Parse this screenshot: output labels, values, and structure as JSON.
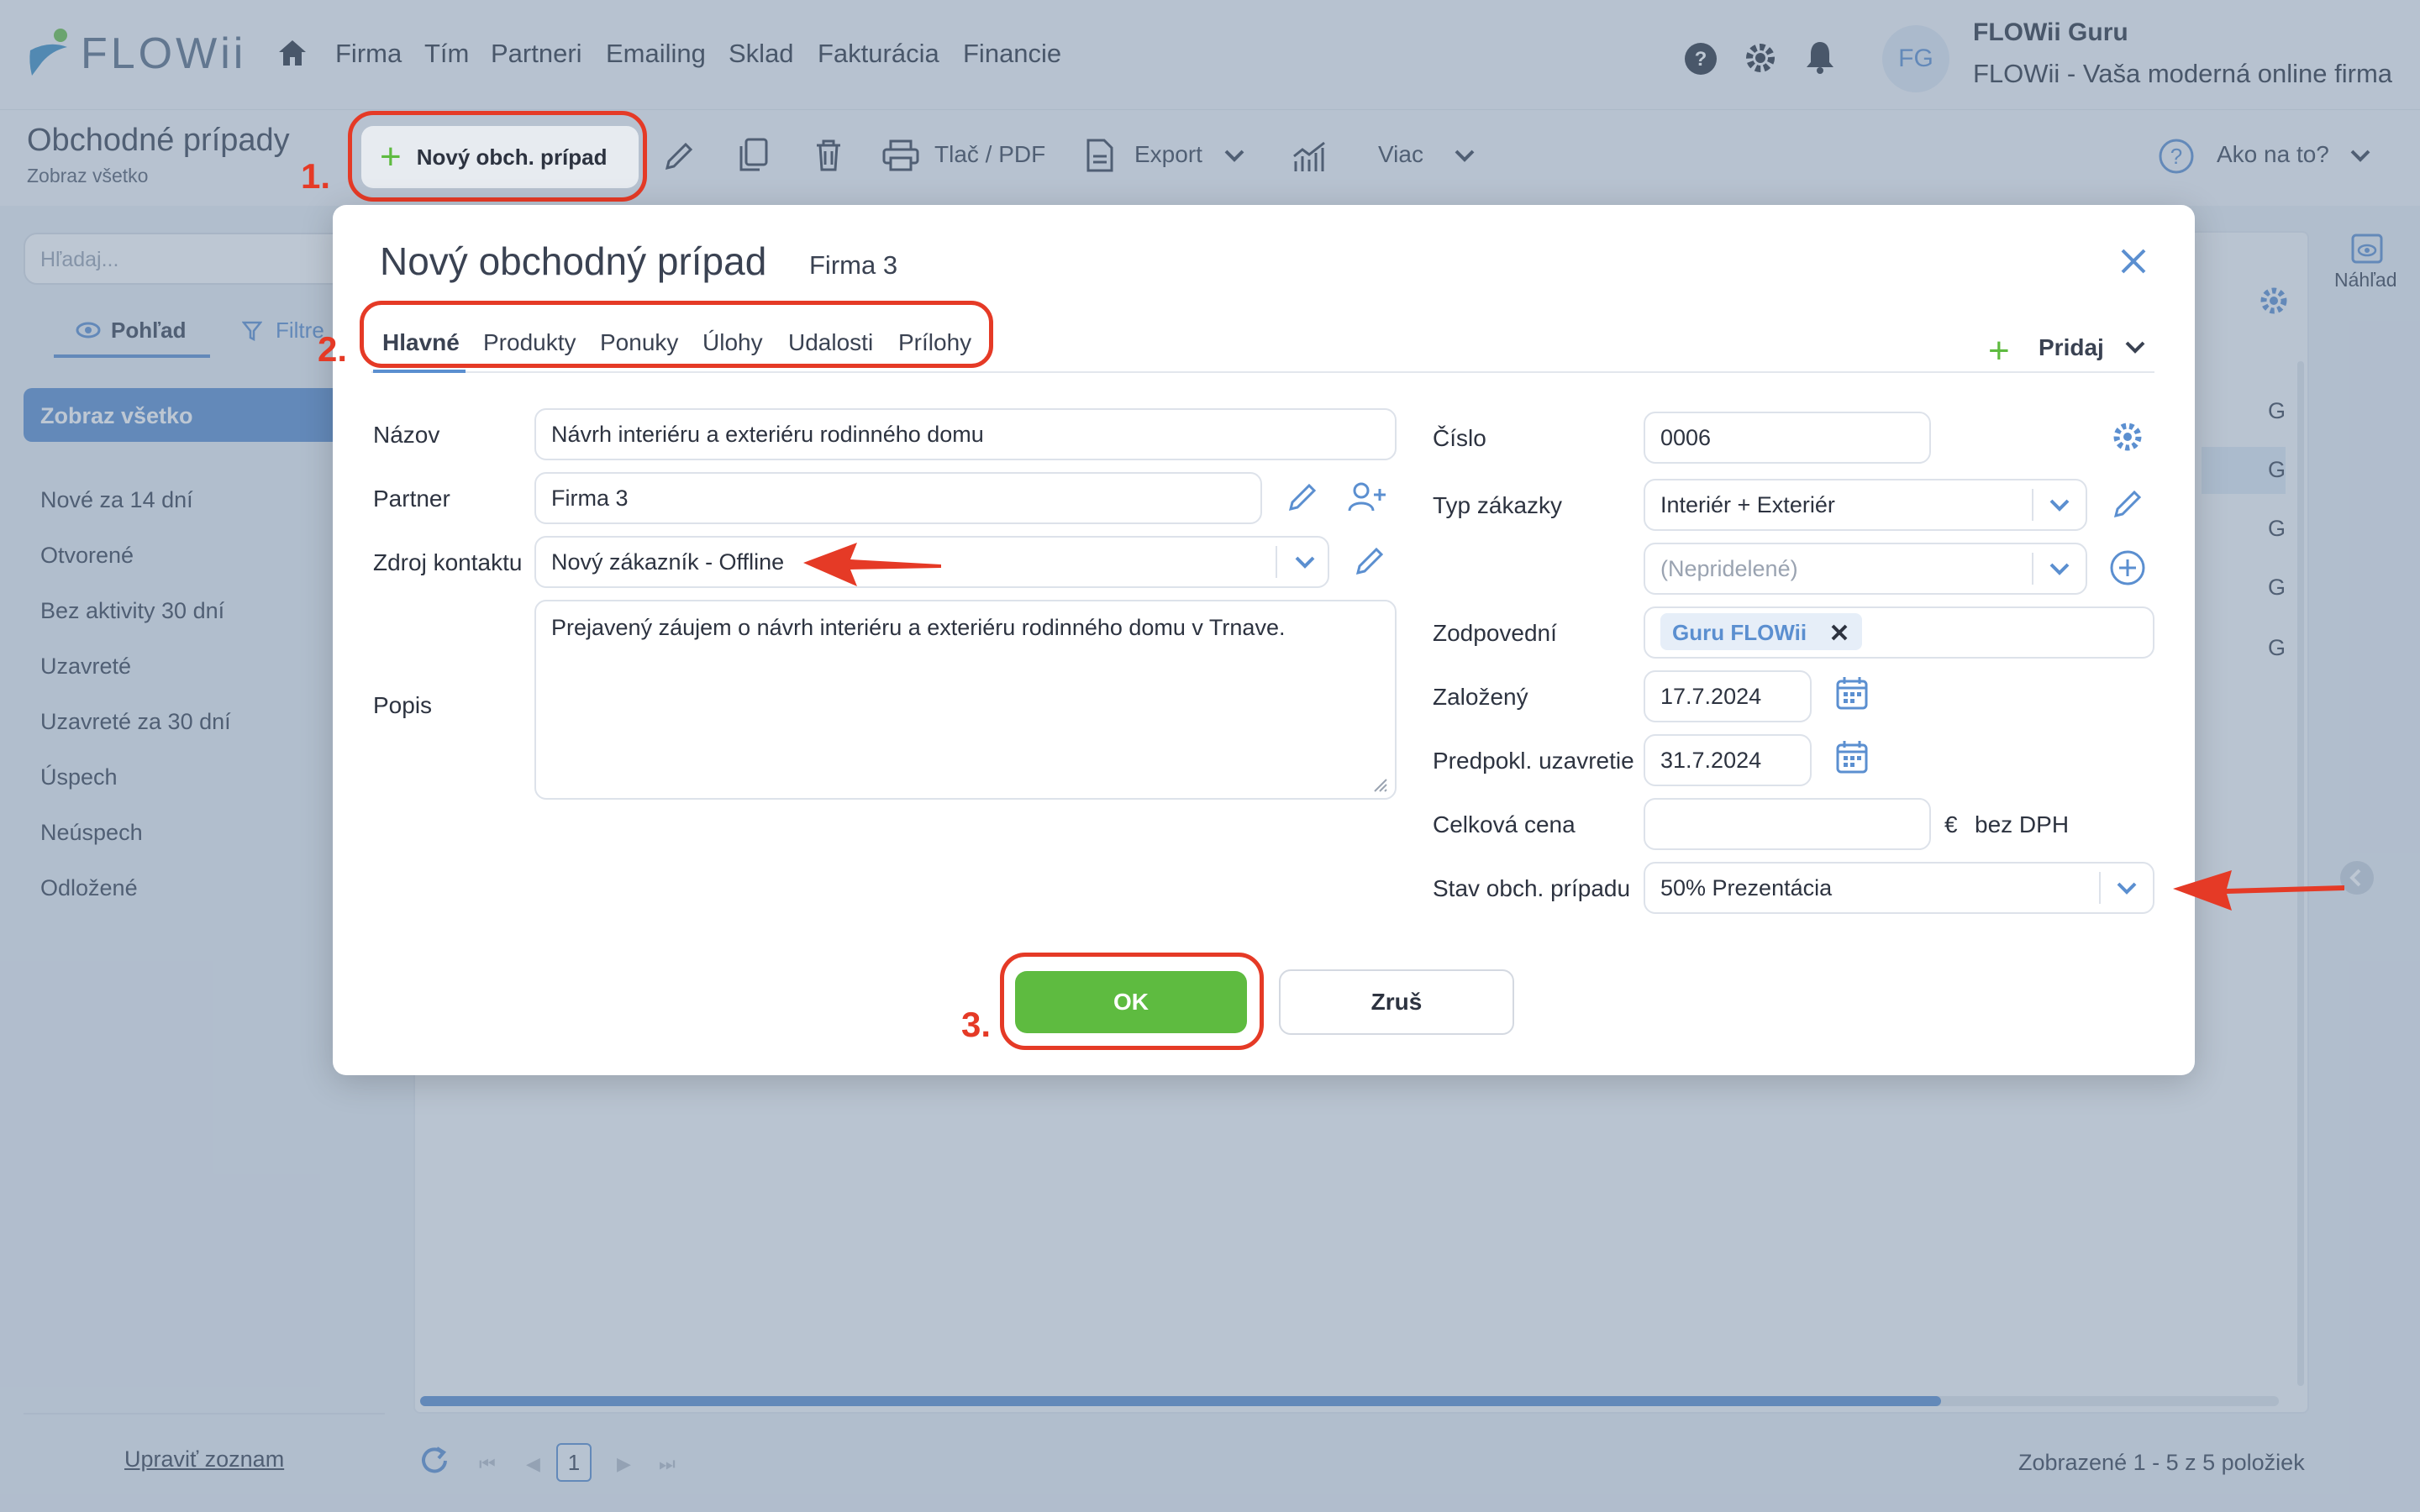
{
  "app": {
    "logo": "FLOWii",
    "nav": [
      "Firma",
      "Tím",
      "Partneri",
      "Emailing",
      "Sklad",
      "Fakturácia",
      "Financie"
    ],
    "user": {
      "initials": "FG",
      "name": "FLOWii Guru",
      "company": "FLOWii - Vaša moderná online firma"
    }
  },
  "toolbar": {
    "page_title": "Obchodné prípady",
    "page_subtitle": "Zobraz všetko",
    "new_button": "Nový obch. prípad",
    "print": "Tlač / PDF",
    "export": "Export",
    "more": "Viac",
    "help": "Ako na to?"
  },
  "left": {
    "search_placeholder": "Hľadaj...",
    "view_tab": "Pohľad",
    "filter_tab": "Filtre",
    "selected": "Zobraz všetko",
    "items": [
      "Nové za 14 dní",
      "Otvorené",
      "Bez aktivity 30 dní",
      "Uzavreté",
      "Uzavreté za 30 dní",
      "Úspech",
      "Neúspech",
      "Odložené"
    ],
    "edit_list": "Upraviť zoznam"
  },
  "content": {
    "row_letters": [
      "G",
      "G",
      "G",
      "G",
      "G"
    ],
    "preview": "Náhľad",
    "page": "1",
    "pager_info": "Zobrazené 1 - 5 z 5 položiek"
  },
  "modal": {
    "title": "Nový obchodný prípad",
    "firm": "Firma 3",
    "tabs": [
      "Hlavné",
      "Produkty",
      "Ponuky",
      "Úlohy",
      "Udalosti",
      "Prílohy"
    ],
    "add": "Pridaj",
    "left_fields": {
      "name_label": "Názov",
      "name_value": "Návrh interiéru a exteriéru rodinného domu",
      "partner_label": "Partner",
      "partner_value": "Firma 3",
      "source_label": "Zdroj kontaktu",
      "source_value": "Nový zákazník - Offline",
      "desc_label": "Popis",
      "desc_value": "Prejavený záujem o návrh interiéru a exteriéru rodinného domu v Trnave."
    },
    "right_fields": {
      "number_label": "Číslo",
      "number_value": "0006",
      "type_label": "Typ zákazky",
      "type_value": "Interiér + Exteriér",
      "unassigned_placeholder": "(Nepridelené)",
      "responsible_label": "Zodpovední",
      "responsible_tag": "Guru FLOWii",
      "created_label": "Založený",
      "created_value": "17.7.2024",
      "expected_label": "Predpokl. uzavretie",
      "expected_value": "31.7.2024",
      "price_label": "Celková cena",
      "price_value": "",
      "currency": "€",
      "vat_note": "bez DPH",
      "state_label": "Stav obch. prípadu",
      "state_value": "50% Prezentácia"
    },
    "ok": "OK",
    "cancel": "Zruš"
  },
  "annotations": {
    "step1": "1.",
    "step2": "2.",
    "step3": "3.",
    "color": "#e53a26"
  },
  "colors": {
    "accent": "#5b8fd0",
    "ok_green": "#5ebb40",
    "annotation_red": "#e53a26"
  }
}
